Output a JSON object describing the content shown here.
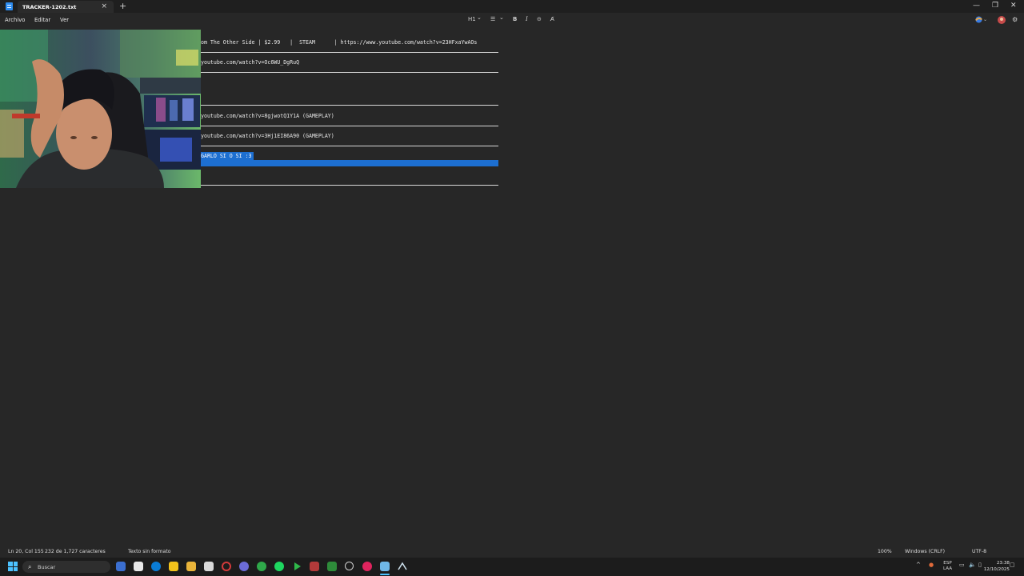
{
  "window": {
    "tab_title": "TRACKER-1202.txt",
    "tab_close": "×",
    "new_tab": "+",
    "minimize": "—",
    "maximize": "❐",
    "close": "✕"
  },
  "menu": {
    "file": "Archivo",
    "edit": "Editar",
    "view": "Ver"
  },
  "format_toolbar": {
    "heading": "H1",
    "heading_chevron": "⌄",
    "list": "☰",
    "list_chevron": "⌄",
    "bold": "B",
    "italic": "I",
    "link": "⊝",
    "clear_format": "A̸"
  },
  "editor": {
    "lines": [
      "om The Other Side | $2.99   |  STEAM      | https://www.youtube.com/watch?v=23HFxaYwAOs",
      "youtube.com/watch?v=Oc6WU_DgRuQ",
      "youtube.com/watch?v=8gjwotQ1Y1A (GAMEPLAY)",
      "youtube.com/watch?v=3Hj1EI86A90 (GAMEPLAY)"
    ],
    "selected_text": "GARLO SI O SI :3"
  },
  "status": {
    "position": "Ln 20, Col 155",
    "characters": "232 de 1,727 caracteres",
    "format": "Texto sin formato",
    "zoom": "100%",
    "line_endings": "Windows (CRLF)",
    "encoding": "UTF-8"
  },
  "taskbar": {
    "search_placeholder": "Buscar",
    "search_icon": "⌕",
    "tray_chevron": "^",
    "language": "ESP",
    "layout": "LAA",
    "time": "23:38",
    "date": "12/10/2025"
  },
  "colors": {
    "editor_bg": "#272727",
    "selection": "#1d6fd1",
    "taskbar_bg": "#1c1c1c"
  }
}
